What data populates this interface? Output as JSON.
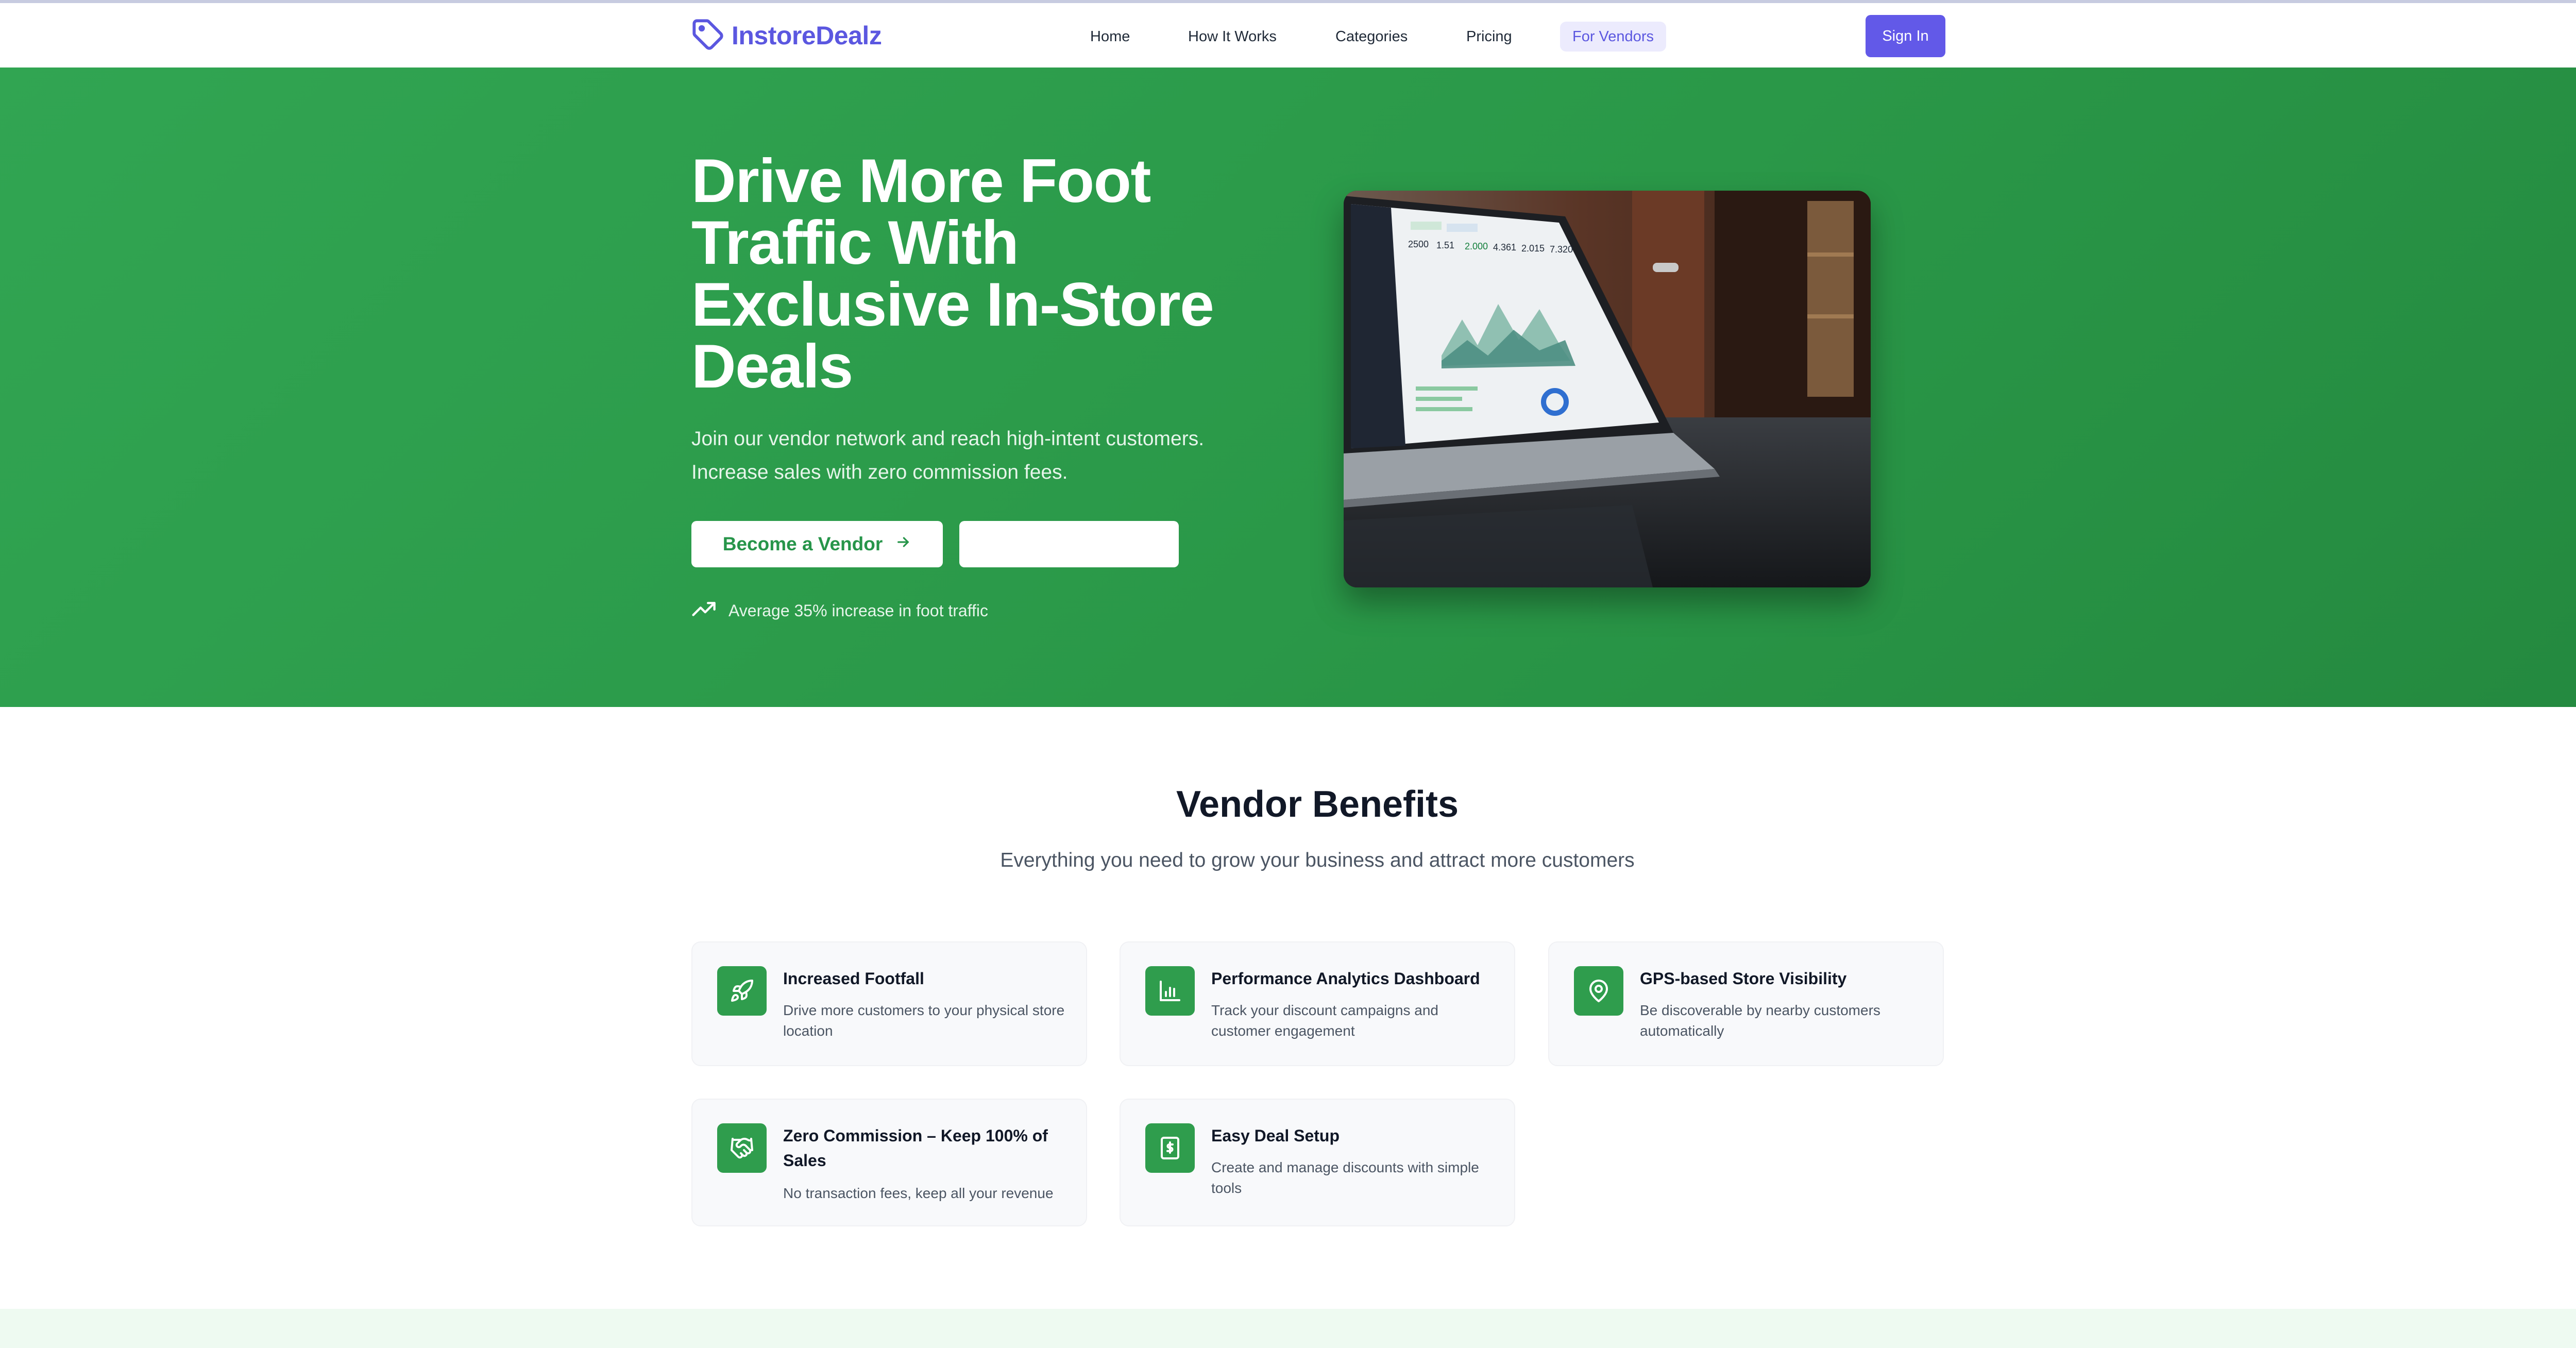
{
  "nav": {
    "brand": "InstoreDealz",
    "links": [
      "Home",
      "How It Works",
      "Categories",
      "Pricing",
      "For Vendors"
    ],
    "active_link": "For Vendors",
    "signin_label": "Sign In"
  },
  "hero": {
    "title": "Drive More Foot Traffic With Exclusive In-Store Deals",
    "subtitle_line1": "Join our vendor network and reach high-intent customers.",
    "subtitle_line2": "Increase sales with zero commission fees.",
    "primary_button": "Become a Vendor",
    "secondary_button": "",
    "stat": "Average 35% increase in foot traffic",
    "image_dashboard_kpis": [
      "2500",
      "1.51",
      "2.000",
      "4.361",
      "2.015",
      "7.320"
    ]
  },
  "benefits": {
    "title": "Vendor Benefits",
    "subtitle": "Everything you need to grow your business and attract more customers",
    "items": [
      {
        "title": "Increased Footfall",
        "desc": "Drive more customers to your physical store location",
        "icon": "rocket-icon"
      },
      {
        "title": "Performance Analytics Dashboard",
        "desc": "Track your discount campaigns and customer engagement",
        "icon": "bar-chart-icon"
      },
      {
        "title": "GPS-based Store Visibility",
        "desc": "Be discoverable by nearby customers automatically",
        "icon": "map-pin-icon"
      },
      {
        "title": "Zero Commission – Keep 100% of Sales",
        "desc": "No transaction fees, keep all your revenue",
        "icon": "handshake-icon"
      },
      {
        "title": "Easy Deal Setup",
        "desc": "Create and manage discounts with simple tools",
        "icon": "receipt-icon"
      }
    ]
  },
  "colors": {
    "brand": "#5b57e0",
    "signin_bg": "#6259e8",
    "hero_green": "#2a9848",
    "icon_green": "#2f9d4d"
  }
}
